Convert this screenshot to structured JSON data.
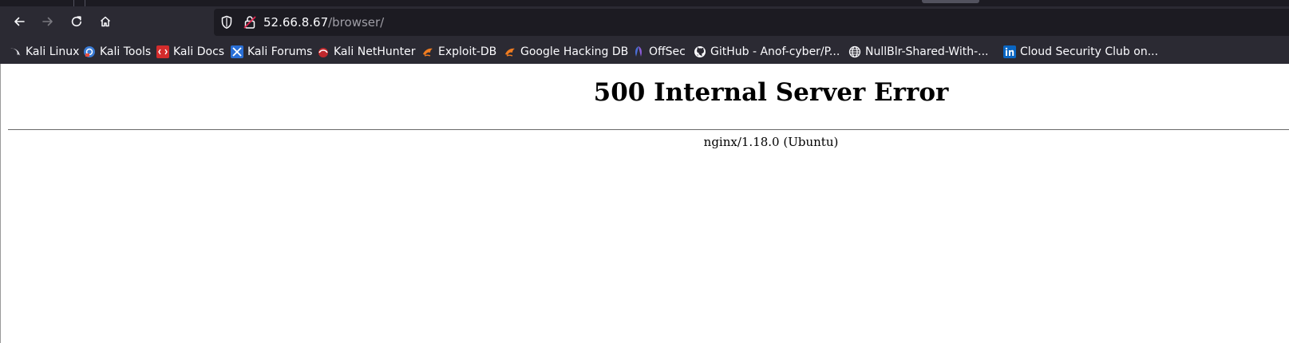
{
  "browser": {
    "url": {
      "host": "52.66.8.67",
      "path": "/browser/"
    },
    "nav": {
      "back_icon": "back-arrow-icon",
      "forward_icon": "forward-arrow-icon",
      "reload_icon": "reload-icon",
      "home_icon": "home-icon"
    },
    "bookmarks": [
      {
        "label": "Kali Linux",
        "icon": "kali-dragon-icon"
      },
      {
        "label": "Kali Tools",
        "icon": "kali-tools-icon"
      },
      {
        "label": "Kali Docs",
        "icon": "kali-docs-icon"
      },
      {
        "label": "Kali Forums",
        "icon": "kali-forums-icon"
      },
      {
        "label": "Kali NetHunter",
        "icon": "kali-nethunter-icon"
      },
      {
        "label": "Exploit-DB",
        "icon": "exploit-db-icon"
      },
      {
        "label": "Google Hacking DB",
        "icon": "exploit-db-icon"
      },
      {
        "label": "OffSec",
        "icon": "offsec-icon"
      },
      {
        "label": "GitHub - Anof-cyber/P...",
        "icon": "github-icon"
      },
      {
        "label": "NullBlr-Shared-With-...",
        "icon": "globe-icon"
      },
      {
        "label": "Cloud Security Club on...",
        "icon": "linkedin-icon"
      }
    ],
    "colors": {
      "chrome_bg": "#2b2a33",
      "urlbar_bg": "#1c1b22",
      "text": "#fbfbfe",
      "url_path": "#9f9ea6"
    }
  },
  "page": {
    "title": "500 Internal Server Error",
    "server_signature": "nginx/1.18.0 (Ubuntu)"
  }
}
